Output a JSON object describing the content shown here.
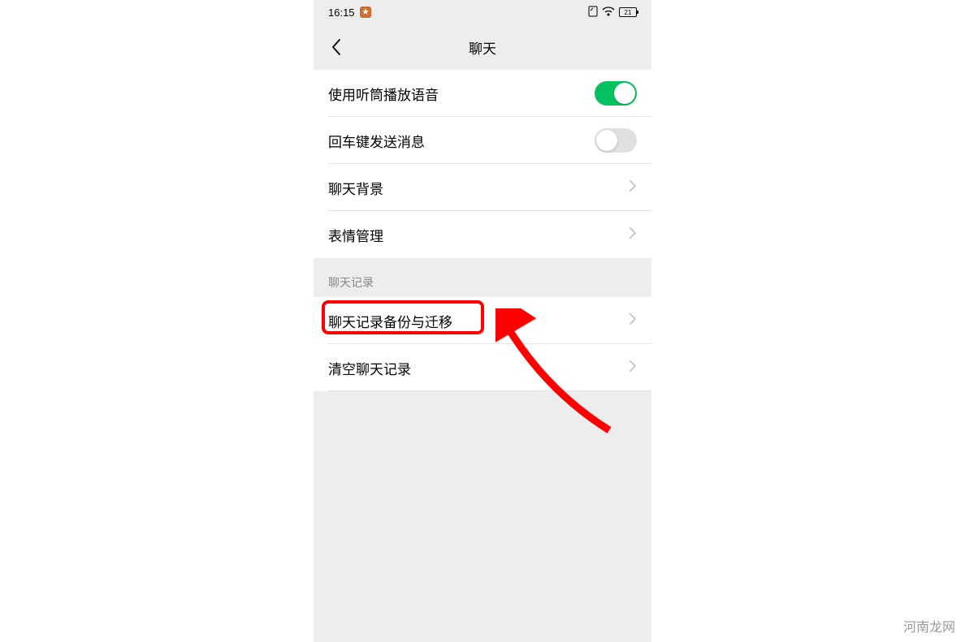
{
  "statusBar": {
    "time": "16:15",
    "batteryText": "21"
  },
  "header": {
    "title": "聊天"
  },
  "group1": {
    "rows": [
      {
        "label": "使用听筒播放语音",
        "type": "toggle",
        "on": true
      },
      {
        "label": "回车键发送消息",
        "type": "toggle",
        "on": false
      },
      {
        "label": "聊天背景",
        "type": "nav"
      },
      {
        "label": "表情管理",
        "type": "nav"
      }
    ]
  },
  "section2Header": "聊天记录",
  "group2": {
    "rows": [
      {
        "label": "聊天记录备份与迁移",
        "type": "nav",
        "highlighted": true
      },
      {
        "label": "清空聊天记录",
        "type": "nav"
      }
    ]
  },
  "watermark": "河南龙网"
}
